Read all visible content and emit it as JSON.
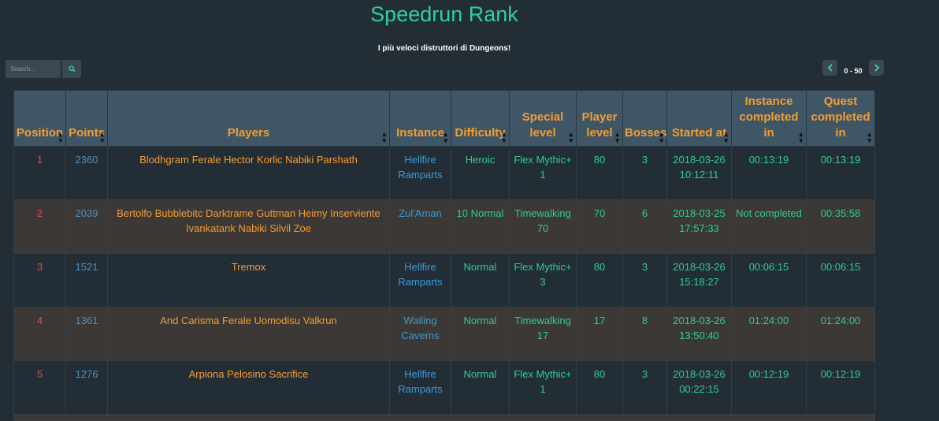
{
  "page": {
    "title": "Speedrun Rank",
    "subtitle": "I più veloci distruttori di Dungeons!"
  },
  "search": {
    "placeholder": "Search..."
  },
  "pager": {
    "label": "0 - 50"
  },
  "table": {
    "headers": {
      "position": "Position",
      "points": "Points",
      "players": "Players",
      "instance": "Instance",
      "difficulty": "Difficulty",
      "special_level": "Special level",
      "player_level": "Player level",
      "bosses": "Bosses",
      "started_at": "Started at",
      "instance_completed": "Instance completed in",
      "quest_completed": "Quest completed in"
    },
    "rows": [
      {
        "position": "1",
        "points": "2360",
        "players": "Blodhgram Ferale Hector Korlic Nabiki Parshath",
        "instance": "Hellfire Ramparts",
        "difficulty": "Heroic",
        "special_level": "Flex Mythic+ 1",
        "player_level": "80",
        "bosses": "3",
        "started_at": "2018-03-26 10:12:11",
        "instance_completed": "00:13:19",
        "quest_completed": "00:13:19"
      },
      {
        "position": "2",
        "points": "2039",
        "players": "Bertolfo Bubblebitc Darktrame Guttman Heimy Inserviente Ivankatank Nabiki Silvil Zoe",
        "instance": "Zul'Aman",
        "difficulty": "10 Normal",
        "special_level": "Timewalking 70",
        "player_level": "70",
        "bosses": "6",
        "started_at": "2018-03-25 17:57:33",
        "instance_completed": "Not completed",
        "quest_completed": "00:35:58"
      },
      {
        "position": "3",
        "points": "1521",
        "players": "Tremox",
        "instance": "Hellfire Ramparts",
        "difficulty": "Normal",
        "special_level": "Flex Mythic+ 3",
        "player_level": "80",
        "bosses": "3",
        "started_at": "2018-03-26 15:18:27",
        "instance_completed": "00:06:15",
        "quest_completed": "00:06:15"
      },
      {
        "position": "4",
        "points": "1361",
        "players": "And Carisma Ferale Uomodisu Valkrun",
        "instance": "Wailing Caverns",
        "difficulty": "Normal",
        "special_level": "Timewalking 17",
        "player_level": "17",
        "bosses": "8",
        "started_at": "2018-03-26 13:50:40",
        "instance_completed": "01:24:00",
        "quest_completed": "01:24:00"
      },
      {
        "position": "5",
        "points": "1276",
        "players": "Arpiona Pelosino Sacrifice",
        "instance": "Hellfire Ramparts",
        "difficulty": "Normal",
        "special_level": "Flex Mythic+ 1",
        "player_level": "80",
        "bosses": "3",
        "started_at": "2018-03-26 00:22:15",
        "instance_completed": "00:12:19",
        "quest_completed": "00:12:19"
      }
    ]
  },
  "icons": {
    "search": "search-icon",
    "prev": "chevron-left-icon",
    "next": "chevron-right-icon",
    "sort": "sort-caret-icon"
  },
  "colors": {
    "background": "#232d35",
    "accent_green": "#2ed19a",
    "header_bg": "#3e5666",
    "header_text": "#f39d33",
    "position": "#e34d4d",
    "points": "#4f8fc0",
    "instance": "#3a9ad9"
  }
}
